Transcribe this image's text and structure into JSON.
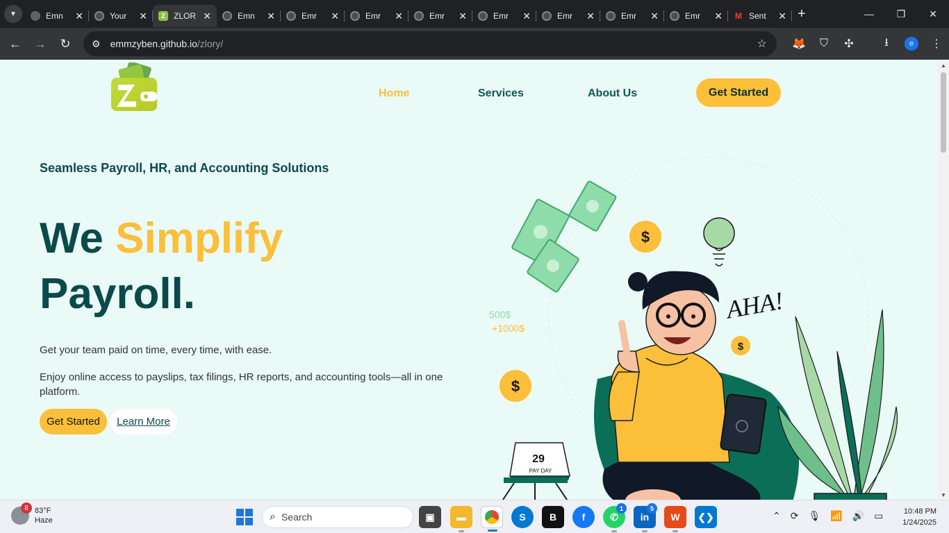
{
  "browser": {
    "tabs": [
      {
        "title": "Emn",
        "icon": "globe-icon",
        "active": false
      },
      {
        "title": "Your",
        "icon": "github-icon",
        "active": false
      },
      {
        "title": "ZLOR",
        "icon": "zlory-icon",
        "active": true
      },
      {
        "title": "Emn",
        "icon": "github-icon",
        "active": false
      },
      {
        "title": "Emr",
        "icon": "github-icon",
        "active": false
      },
      {
        "title": "Emr",
        "icon": "github-icon",
        "active": false
      },
      {
        "title": "Emr",
        "icon": "github-icon",
        "active": false
      },
      {
        "title": "Emr",
        "icon": "github-icon",
        "active": false
      },
      {
        "title": "Emr",
        "icon": "github-icon",
        "active": false
      },
      {
        "title": "Emr",
        "icon": "github-icon",
        "active": false
      },
      {
        "title": "Emr",
        "icon": "github-icon",
        "active": false
      },
      {
        "title": "Sent",
        "icon": "gmail-icon",
        "active": false
      }
    ],
    "url_host": "emmzyben.github.io",
    "url_path": "/zlory/",
    "profile_initial": "e"
  },
  "site": {
    "nav": {
      "home": "Home",
      "services": "Services",
      "about": "About Us",
      "cta": "Get Started"
    },
    "tagline": "Seamless Payroll, HR, and Accounting Solutions",
    "hero_line1_a": "We ",
    "hero_line1_b": "Simplify",
    "hero_line2": "Payroll.",
    "desc1": "Get your team paid on time, every time, with ease.",
    "desc2": "Enjoy online access to payslips, tax filings, HR reports, and accounting tools—all in one platform.",
    "btn_primary": "Get Started",
    "btn_secondary": "Learn More",
    "illustration": {
      "aha": "AHA!",
      "amount1": "500$",
      "amount2": "+1000$",
      "calendar_day": "29",
      "calendar_label": "PAY DAY",
      "coin_symbol": "$"
    },
    "colors": {
      "accent": "#fbbf3a",
      "primary": "#0b4a4a",
      "background": "#eafaf7"
    }
  },
  "taskbar": {
    "weather_temp": "83°F",
    "weather_desc": "Haze",
    "weather_badge": "8",
    "search_placeholder": "Search",
    "whatsapp_badge": "1",
    "linkedin_badge": "5",
    "time": "10:48 PM",
    "date": "1/24/2025"
  }
}
